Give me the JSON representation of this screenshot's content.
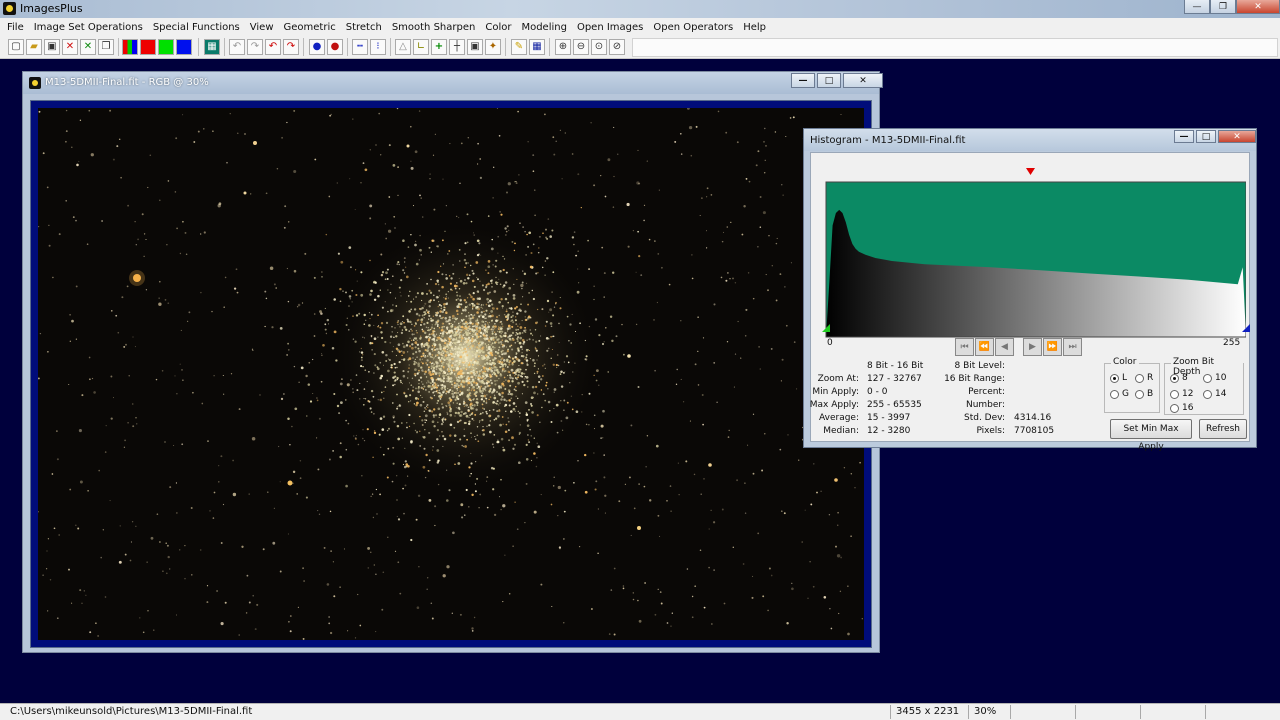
{
  "app": {
    "title": "ImagesPlus",
    "colors": {
      "desktop": "#00003c",
      "histogram_fill": "#0b8a64",
      "image_frame": "#000c7a"
    }
  },
  "menu": [
    "File",
    "Image Set Operations",
    "Special Functions",
    "View",
    "Geometric",
    "Stretch",
    "Smooth Sharpen",
    "Color",
    "Modeling",
    "Open Images",
    "Open Operators",
    "Help"
  ],
  "toolbar": {
    "icons": [
      "new-file-icon",
      "open-folder-icon",
      "save-icon",
      "close-red-x-icon",
      "close-green-x-icon",
      "copy-icon",
      "rgb-channels-icon",
      "red-channel-icon",
      "green-channel-icon",
      "blue-channel-icon",
      "grid-icon",
      "undo-icon",
      "redo-icon",
      "undo-red-icon",
      "redo-red-icon",
      "blue-dot-icon",
      "red-dot-icon",
      "line-icon",
      "points-icon",
      "triangle-icon",
      "angle-icon",
      "crosshair-green-icon",
      "crosshair-icon",
      "select-box-icon",
      "paint-icon",
      "pencil-icon",
      "grid-select-icon",
      "zoom-in-icon",
      "zoom-out-icon",
      "zoom-fit-icon",
      "zoom-actual-icon"
    ]
  },
  "image_window": {
    "title": "M13-5DMII-Final.fit - RGB @ 30%"
  },
  "histogram": {
    "title": "Histogram - M13-5DMII-Final.fit",
    "axis_min": "0",
    "axis_max": "255",
    "col_header": "8 Bit - 16 Bit",
    "stats_left": [
      {
        "label": "Zoom At:",
        "value": "127 - 32767"
      },
      {
        "label": "Min Apply:",
        "value": "0 - 0"
      },
      {
        "label": "Max Apply:",
        "value": "255 - 65535"
      },
      {
        "label": "Average:",
        "value": "15 - 3997"
      },
      {
        "label": "Median:",
        "value": "12 - 3280"
      }
    ],
    "stats_right": [
      {
        "label": "8 Bit Level:",
        "value": ""
      },
      {
        "label": "16 Bit Range:",
        "value": ""
      },
      {
        "label": "Percent:",
        "value": ""
      },
      {
        "label": "Number:",
        "value": ""
      },
      {
        "label": "Std. Dev:",
        "value": "4314.16"
      },
      {
        "label": "Pixels:",
        "value": "7708105"
      }
    ],
    "color_group": {
      "title": "Color",
      "options": [
        "L",
        "R",
        "G",
        "B"
      ],
      "selected": "L"
    },
    "zoom_group": {
      "title": "Zoom Bit Depth",
      "options": [
        "8",
        "10",
        "12",
        "14",
        "16"
      ],
      "selected": "8"
    },
    "set_button": "Set Min Max Apply",
    "refresh_button": "Refresh",
    "chart_data": {
      "type": "area",
      "xlim": [
        0,
        255
      ],
      "x": [
        0,
        2,
        4,
        6,
        8,
        10,
        12,
        14,
        16,
        18,
        20,
        24,
        30,
        40,
        60,
        80,
        100,
        130,
        160,
        190,
        220,
        240,
        250,
        253,
        255
      ],
      "values": [
        0.0,
        0.35,
        0.72,
        0.8,
        0.82,
        0.8,
        0.74,
        0.66,
        0.6,
        0.57,
        0.55,
        0.53,
        0.51,
        0.49,
        0.47,
        0.46,
        0.45,
        0.43,
        0.41,
        0.39,
        0.37,
        0.35,
        0.34,
        0.45,
        0.0
      ],
      "ylim": [
        0,
        1
      ],
      "grid": false
    }
  },
  "status": {
    "path": "C:\\Users\\mikeunsold\\Pictures\\M13-5DMII-Final.fit",
    "dimensions": "3455 x 2231",
    "zoom": "30%"
  }
}
